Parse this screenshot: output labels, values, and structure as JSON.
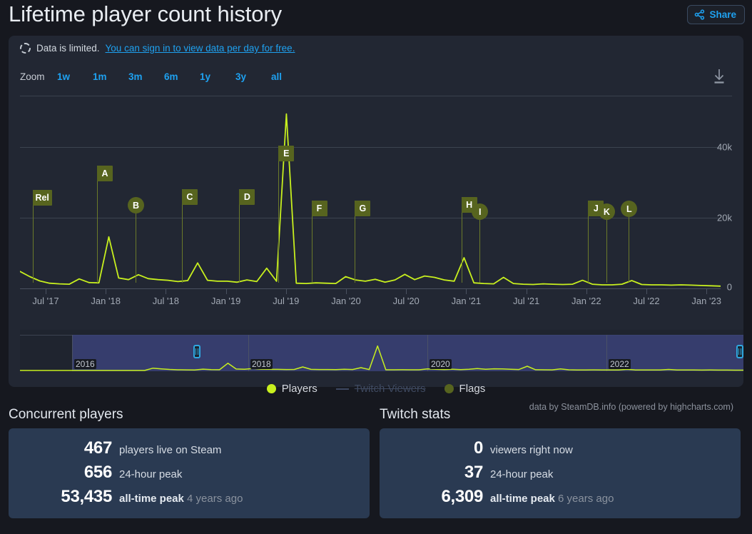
{
  "header": {
    "title": "Lifetime player count history",
    "share_label": "Share",
    "share_icon": "share-network-icon"
  },
  "chart_card": {
    "notice_text": "Data is limited.",
    "notice_link": "You can sign in to view data per day for free.",
    "notice_icon": "dashed-circle-icon",
    "zoom_label": "Zoom",
    "zoom_buttons": [
      "1w",
      "1m",
      "3m",
      "6m",
      "1y",
      "3y",
      "all"
    ],
    "download_icon": "download-icon",
    "credits": "data by SteamDB.info (powered by highcharts.com)",
    "legend": [
      {
        "label": "Players",
        "marker": "dot",
        "color": "#c8f01e",
        "enabled": true
      },
      {
        "label": "Twitch Viewers",
        "marker": "dash",
        "color": "#3d4861",
        "enabled": false
      },
      {
        "label": "Flags",
        "marker": "dot",
        "color": "#57641f",
        "enabled": true
      }
    ],
    "navigator": {
      "year_labels": [
        "2016",
        "2018",
        "2020",
        "2022"
      ],
      "left_handle": "navigator-left-handle",
      "right_handle": "navigator-right-handle"
    }
  },
  "chart_data": {
    "type": "line",
    "title": "Lifetime player count history",
    "xlabel": "",
    "ylabel": "",
    "ylim": [
      0,
      56000
    ],
    "yticks": [
      0,
      20000,
      40000
    ],
    "ytick_labels": [
      "0",
      "20k",
      "40k"
    ],
    "grid": true,
    "legend_position": "bottom-center",
    "xticks": [
      "Jul '17",
      "Jan '18",
      "Jul '18",
      "Jan '19",
      "Jul '19",
      "Jan '20",
      "Jul '20",
      "Jan '21",
      "Jul '21",
      "Jan '22",
      "Jul '22",
      "Jan '23"
    ],
    "series": [
      {
        "name": "Players",
        "color": "#c8f01e",
        "x": [
          "2017-04",
          "2017-05",
          "2017-06",
          "2017-07",
          "2017-08",
          "2017-09",
          "2017-10",
          "2017-11",
          "2017-12",
          "2018-01",
          "2018-02",
          "2018-03",
          "2018-04",
          "2018-05",
          "2018-06",
          "2018-07",
          "2018-08",
          "2018-09",
          "2018-10",
          "2018-11",
          "2018-12",
          "2019-01",
          "2019-02",
          "2019-03",
          "2019-04",
          "2019-05",
          "2019-06",
          "2019-07",
          "2019-08",
          "2019-09",
          "2019-10",
          "2019-11",
          "2019-12",
          "2020-01",
          "2020-02",
          "2020-03",
          "2020-04",
          "2020-05",
          "2020-06",
          "2020-07",
          "2020-08",
          "2020-09",
          "2020-10",
          "2020-11",
          "2020-12",
          "2021-01",
          "2021-02",
          "2021-03",
          "2021-04",
          "2021-05",
          "2021-06",
          "2021-07",
          "2021-08",
          "2021-09",
          "2021-10",
          "2021-11",
          "2021-12",
          "2022-01",
          "2022-02",
          "2022-03",
          "2022-04",
          "2022-05",
          "2022-06",
          "2022-07",
          "2022-08",
          "2022-09",
          "2022-10",
          "2022-11",
          "2022-12",
          "2023-01",
          "2023-02",
          "2023-03"
        ],
        "values": [
          5200,
          3600,
          2300,
          1600,
          1400,
          1300,
          2900,
          1800,
          1700,
          15800,
          3200,
          2700,
          4200,
          3000,
          2700,
          2500,
          2100,
          2400,
          7800,
          2500,
          2200,
          2200,
          1900,
          2600,
          2100,
          6200,
          2200,
          53435,
          1600,
          1500,
          1700,
          1600,
          1500,
          3600,
          2600,
          2200,
          2800,
          1900,
          2600,
          4300,
          2700,
          3800,
          3400,
          2600,
          2200,
          9400,
          1700,
          1500,
          1400,
          3400,
          1500,
          1300,
          1200,
          1400,
          1300,
          1200,
          1300,
          2500,
          1300,
          1100,
          1100,
          1300,
          2400,
          1200,
          1100,
          1100,
          1000,
          1100,
          1000,
          900,
          800,
          700
        ]
      }
    ],
    "flags": [
      {
        "id": "Rel",
        "shape": "square",
        "x_pct": 1.8,
        "label": "Rel"
      },
      {
        "id": "A",
        "shape": "square",
        "x_pct": 11.0,
        "label": "A"
      },
      {
        "id": "B",
        "shape": "circle",
        "x_pct": 16.5,
        "label": "B"
      },
      {
        "id": "C",
        "shape": "square",
        "x_pct": 23.1,
        "label": "C"
      },
      {
        "id": "D",
        "shape": "square",
        "x_pct": 31.3,
        "label": "D"
      },
      {
        "id": "E",
        "shape": "square",
        "x_pct": 36.9,
        "label": "E"
      },
      {
        "id": "F",
        "shape": "square",
        "x_pct": 41.6,
        "label": "F"
      },
      {
        "id": "G",
        "shape": "square",
        "x_pct": 47.8,
        "label": "G"
      },
      {
        "id": "H",
        "shape": "square",
        "x_pct": 63.0,
        "label": "H"
      },
      {
        "id": "I",
        "shape": "circle",
        "x_pct": 65.6,
        "label": "I"
      },
      {
        "id": "J",
        "shape": "square",
        "x_pct": 81.1,
        "label": "J"
      },
      {
        "id": "K",
        "shape": "circle",
        "x_pct": 83.7,
        "label": "K"
      },
      {
        "id": "L",
        "shape": "circle",
        "x_pct": 86.9,
        "label": "L"
      }
    ]
  },
  "stats": {
    "concurrent": {
      "heading": "Concurrent players",
      "rows": [
        {
          "value": "467",
          "label": "players live on Steam",
          "muted": ""
        },
        {
          "value": "656",
          "label": "24-hour peak",
          "muted": ""
        },
        {
          "value": "53,435",
          "label": "all-time peak",
          "muted": "4 years ago"
        }
      ]
    },
    "twitch": {
      "heading": "Twitch stats",
      "rows": [
        {
          "value": "0",
          "label": "viewers right now",
          "muted": ""
        },
        {
          "value": "37",
          "label": "24-hour peak",
          "muted": ""
        },
        {
          "value": "6,309",
          "label": "all-time peak",
          "muted": "6 years ago"
        }
      ]
    }
  }
}
